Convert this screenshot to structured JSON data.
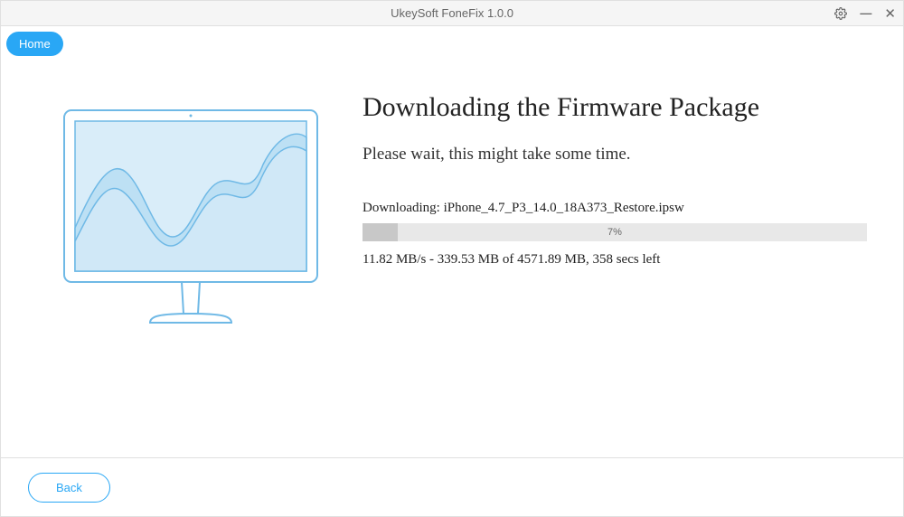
{
  "titlebar": {
    "title": "UkeySoft FoneFix 1.0.0"
  },
  "nav": {
    "home_label": "Home"
  },
  "main": {
    "heading": "Downloading the Firmware Package",
    "subheading": "Please wait, this might take some time.",
    "download_prefix": "Downloading: ",
    "download_filename": "iPhone_4.7_P3_14.0_18A373_Restore.ipsw",
    "progress": {
      "percent_text": "7%",
      "percent_value": 7
    },
    "stats": "11.82 MB/s - 339.53 MB of 4571.89 MB, 358 secs left"
  },
  "footer": {
    "back_label": "Back"
  },
  "colors": {
    "accent": "#29a7f5",
    "illustration_stroke": "#6fb9e6",
    "illustration_fill": "#d0e8f7"
  }
}
